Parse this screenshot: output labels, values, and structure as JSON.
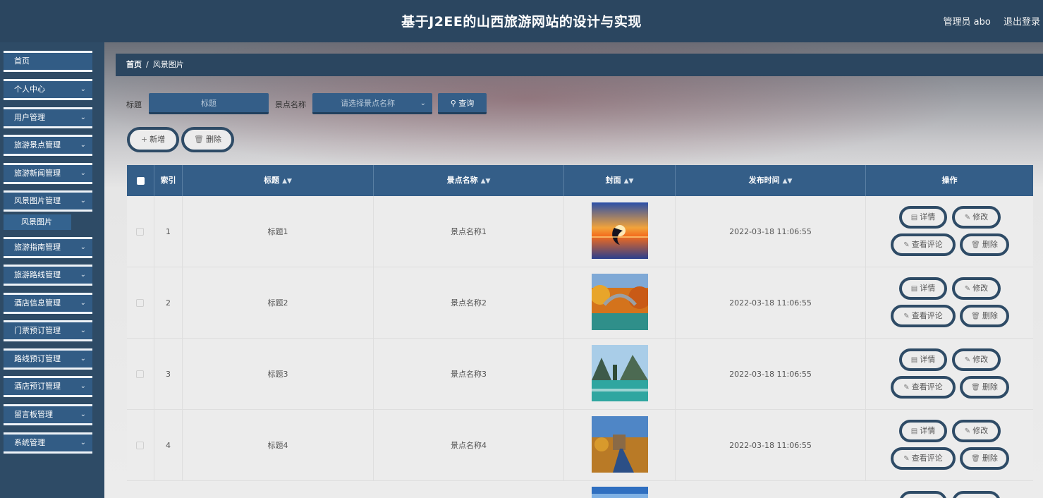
{
  "header": {
    "title": "基于J2EE的山西旅游网站的设计与实现",
    "user": "管理员 abo",
    "logout": "退出登录"
  },
  "sidebar": {
    "items": [
      {
        "label": "首页"
      },
      {
        "label": "个人中心"
      },
      {
        "label": "用户管理"
      },
      {
        "label": "旅游景点管理"
      },
      {
        "label": "旅游新闻管理"
      },
      {
        "label": "风景图片管理"
      },
      {
        "label": "旅游指南管理"
      },
      {
        "label": "旅游路线管理"
      },
      {
        "label": "酒店信息管理"
      },
      {
        "label": "门票预订管理"
      },
      {
        "label": "路线预订管理"
      },
      {
        "label": "酒店预订管理"
      },
      {
        "label": "留言板管理"
      },
      {
        "label": "系统管理"
      }
    ],
    "sub_item": "风景图片"
  },
  "breadcrumb": {
    "home": "首页",
    "sep": "/",
    "current": "风景图片"
  },
  "search": {
    "title_label": "标题",
    "title_placeholder": "标题",
    "spot_label": "景点名称",
    "spot_placeholder": "请选择景点名称",
    "query_button": "查询"
  },
  "actions": {
    "add": "新增",
    "delete": "删除"
  },
  "table": {
    "columns": [
      "索引",
      "标题",
      "景点名称",
      "封面",
      "发布时间",
      "操作"
    ],
    "row_actions": {
      "detail": "详情",
      "edit": "修改",
      "comments": "查看评论",
      "delete": "删除"
    },
    "rows": [
      {
        "index": "1",
        "title": "标题1",
        "spot": "景点名称1",
        "time": "2022-03-18 11:06:55"
      },
      {
        "index": "2",
        "title": "标题2",
        "spot": "景点名称2",
        "time": "2022-03-18 11:06:55"
      },
      {
        "index": "3",
        "title": "标题3",
        "spot": "景点名称3",
        "time": "2022-03-18 11:06:55"
      },
      {
        "index": "4",
        "title": "标题4",
        "spot": "景点名称4",
        "time": "2022-03-18 11:06:55"
      }
    ]
  },
  "colors": {
    "header": "#2b4660",
    "accent": "#345e88",
    "background": "#ececec"
  }
}
